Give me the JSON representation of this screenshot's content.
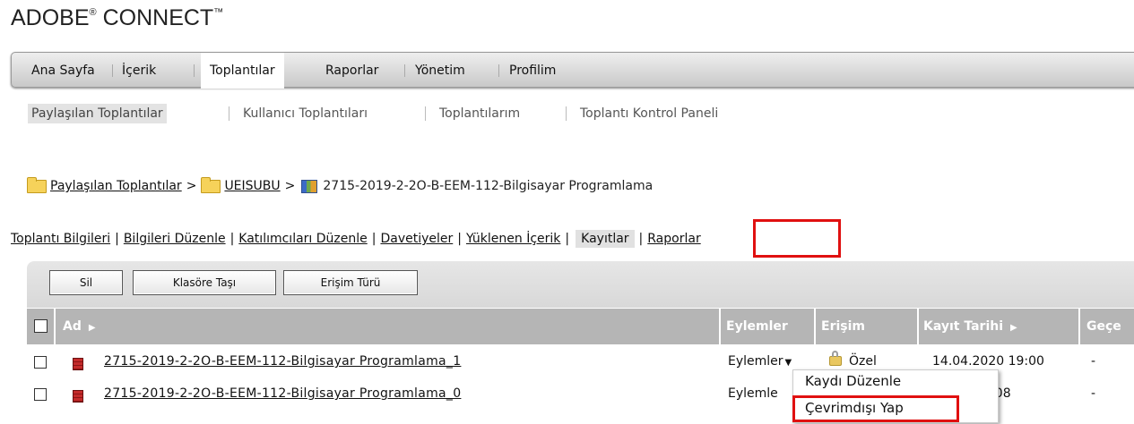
{
  "logo": {
    "text": "ADOBE",
    "reg": "®",
    "text2": " CONNECT",
    "tm": "™"
  },
  "main_nav": [
    "Ana Sayfa",
    "İçerik",
    "Toplantılar",
    "Raporlar",
    "Yönetim",
    "Profilim"
  ],
  "main_nav_active": "Toplantılar",
  "sub_nav": [
    "Paylaşılan Toplantılar",
    "Kullanıcı Toplantıları",
    "Toplantılarım",
    "Toplantı Kontrol Paneli"
  ],
  "breadcrumb": {
    "folder1": "Paylaşılan Toplantılar",
    "folder2": "UEISUBU",
    "meeting": "2715-2019-2-2O-B-EEM-112-Bilgisayar Programlama",
    "sep": ">"
  },
  "tabs": {
    "items": [
      "Toplantı Bilgileri",
      "Bilgileri Düzenle",
      "Katılımcıları Düzenle",
      "Davetiyeler",
      "Yüklenen İçerik",
      "Kayıtlar",
      "Raporlar"
    ],
    "pipe": "|",
    "active": "Kayıtlar"
  },
  "toolbar": {
    "delete": "Sil",
    "move": "Klasöre Taşı",
    "access": "Erişim Türü"
  },
  "table": {
    "headers": {
      "name": "Ad",
      "actions": "Eylemler",
      "access": "Erişim",
      "date": "Kayıt Tarihi",
      "duration": "Geçe"
    },
    "rows": [
      {
        "name": "2715-2019-2-2O-B-EEM-112-Bilgisayar Programlama_1",
        "actions": "Eylemler",
        "access": "Özel",
        "date": "14.04.2020 19:00",
        "duration": "-"
      },
      {
        "name": "2715-2019-2-2O-B-EEM-112-Bilgisayar Programlama_0",
        "actions": "Eylemle",
        "access": "",
        "date": "20 19:08",
        "duration": "-"
      }
    ]
  },
  "popup_menu": {
    "edit": "Kaydı Düzenle",
    "offline": "Çevrimdışı Yap"
  },
  "colors": {
    "highlight": "#e01010",
    "header_bg": "#b5b5b5"
  }
}
